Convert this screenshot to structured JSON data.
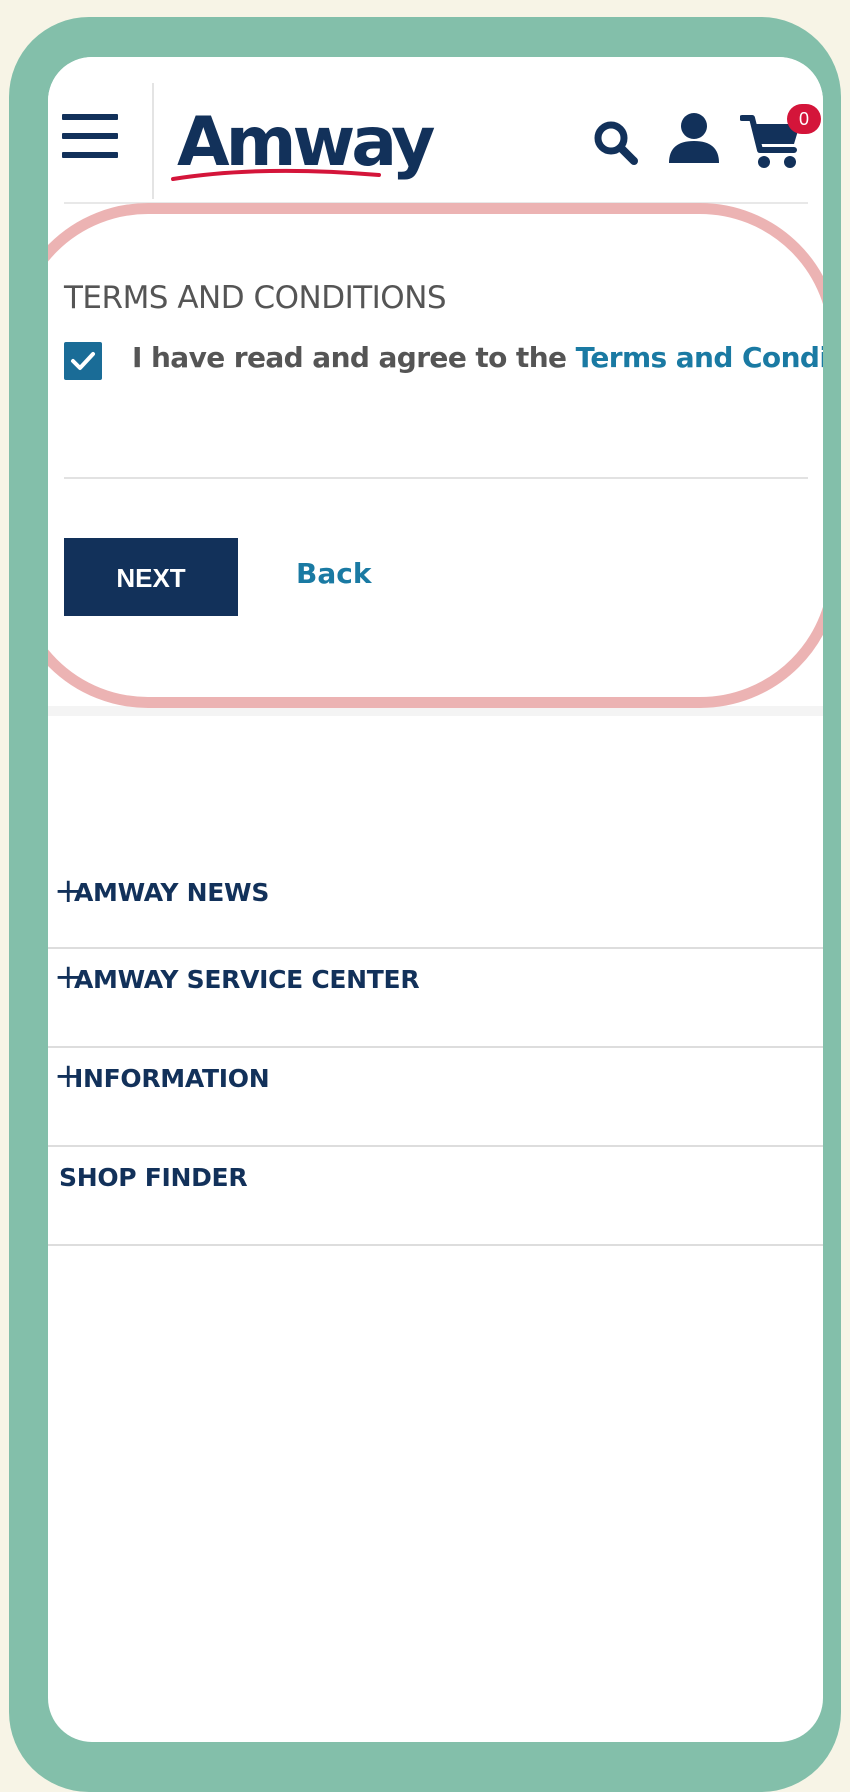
{
  "header": {
    "logo_text": "Amway",
    "cart_count": "0",
    "icons": [
      "menu-icon",
      "search-icon",
      "user-icon",
      "cart-icon"
    ]
  },
  "terms": {
    "title": "TERMS AND CONDITIONS",
    "checkbox_checked": true,
    "agree_text": "I have read and agree to the ",
    "agree_link": "Terms and Conditions"
  },
  "actions": {
    "next_label": "NEXT",
    "back_label": "Back"
  },
  "footer_menu": {
    "items": [
      {
        "label": "AMWAY NEWS",
        "expandable": true
      },
      {
        "label": "AMWAY SERVICE CENTER",
        "expandable": true
      },
      {
        "label": "INFORMATION",
        "expandable": true
      },
      {
        "label": "SHOP FINDER",
        "expandable": false
      }
    ],
    "plus_glyph": "+"
  },
  "colors": {
    "brand_navy": "#12315a",
    "link_blue": "#1a7aa3",
    "frame_green": "#83bfaa",
    "highlight_pink": "#ecb3b3",
    "badge_red": "#d4153a"
  }
}
